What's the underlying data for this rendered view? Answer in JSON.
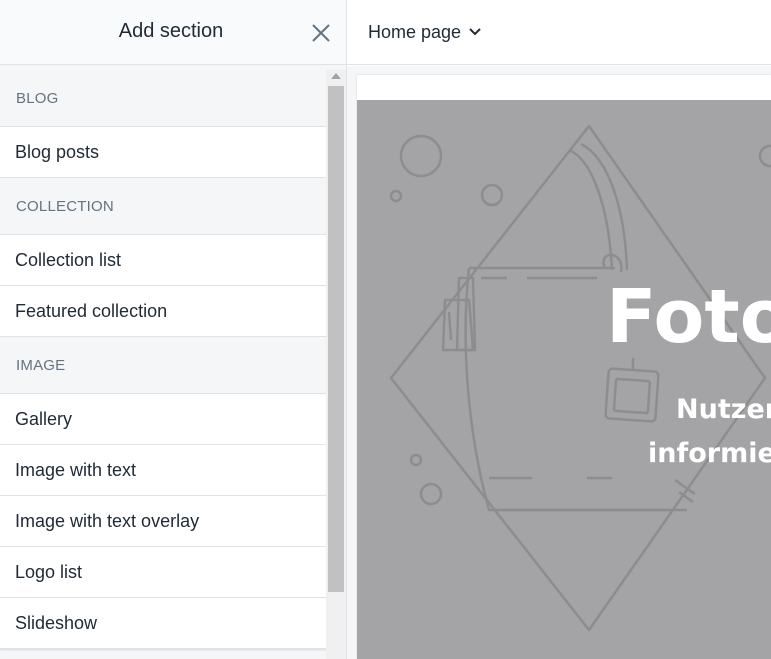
{
  "panel": {
    "title": "Add section",
    "groups": [
      {
        "label": "BLOG",
        "items": [
          "Blog posts"
        ]
      },
      {
        "label": "COLLECTION",
        "items": [
          "Collection list",
          "Featured collection"
        ]
      },
      {
        "label": "IMAGE",
        "items": [
          "Gallery",
          "Image with text",
          "Image with text overlay",
          "Logo list",
          "Slideshow"
        ]
      }
    ]
  },
  "topbar": {
    "page_selector": "Home page"
  },
  "preview": {
    "hero_title": "Foto",
    "hero_subtitle_line1": "Nutzer",
    "hero_subtitle_line2": "informie"
  },
  "colors": {
    "panel_bg": "#f4f6f8",
    "hero_bg": "#a4a4a7",
    "illustration_stroke": "#8d8d90",
    "group_label": "#637381",
    "text": "#212b36"
  },
  "icons": {
    "close": "close-icon",
    "dropdown": "chevron-down-icon",
    "illustration": "handbag-illustration-icon"
  }
}
